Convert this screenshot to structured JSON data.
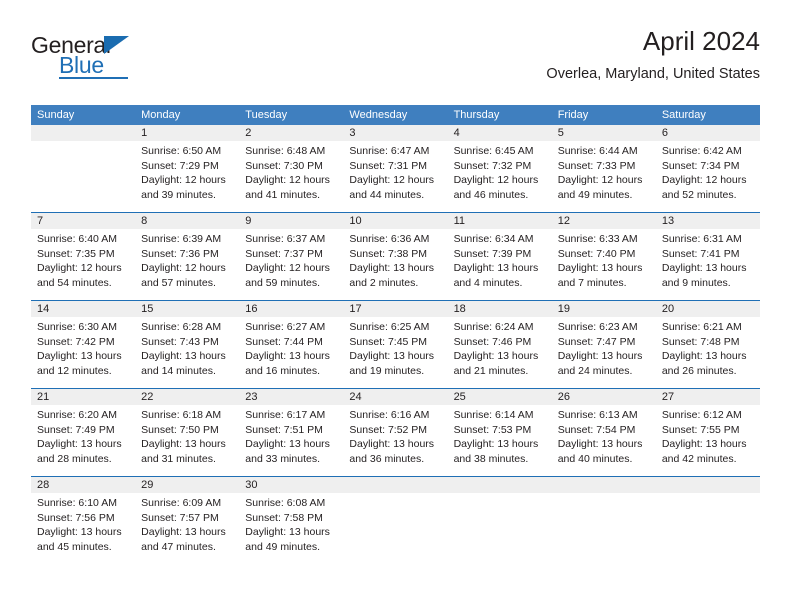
{
  "brand": {
    "name_part1": "General",
    "name_part2": "Blue"
  },
  "header": {
    "title": "April 2024",
    "subtitle": "Overlea, Maryland, United States"
  },
  "colors": {
    "header_blue": "#3f7fbf",
    "rule_blue": "#1f6fb5",
    "day_band_gray": "#efefef",
    "text": "#231f20"
  },
  "weekdays": [
    "Sunday",
    "Monday",
    "Tuesday",
    "Wednesday",
    "Thursday",
    "Friday",
    "Saturday"
  ],
  "weeks": [
    [
      {
        "day": "",
        "sunrise": "",
        "sunset": "",
        "daylight1": "",
        "daylight2": ""
      },
      {
        "day": "1",
        "sunrise": "Sunrise: 6:50 AM",
        "sunset": "Sunset: 7:29 PM",
        "daylight1": "Daylight: 12 hours",
        "daylight2": "and 39 minutes."
      },
      {
        "day": "2",
        "sunrise": "Sunrise: 6:48 AM",
        "sunset": "Sunset: 7:30 PM",
        "daylight1": "Daylight: 12 hours",
        "daylight2": "and 41 minutes."
      },
      {
        "day": "3",
        "sunrise": "Sunrise: 6:47 AM",
        "sunset": "Sunset: 7:31 PM",
        "daylight1": "Daylight: 12 hours",
        "daylight2": "and 44 minutes."
      },
      {
        "day": "4",
        "sunrise": "Sunrise: 6:45 AM",
        "sunset": "Sunset: 7:32 PM",
        "daylight1": "Daylight: 12 hours",
        "daylight2": "and 46 minutes."
      },
      {
        "day": "5",
        "sunrise": "Sunrise: 6:44 AM",
        "sunset": "Sunset: 7:33 PM",
        "daylight1": "Daylight: 12 hours",
        "daylight2": "and 49 minutes."
      },
      {
        "day": "6",
        "sunrise": "Sunrise: 6:42 AM",
        "sunset": "Sunset: 7:34 PM",
        "daylight1": "Daylight: 12 hours",
        "daylight2": "and 52 minutes."
      }
    ],
    [
      {
        "day": "7",
        "sunrise": "Sunrise: 6:40 AM",
        "sunset": "Sunset: 7:35 PM",
        "daylight1": "Daylight: 12 hours",
        "daylight2": "and 54 minutes."
      },
      {
        "day": "8",
        "sunrise": "Sunrise: 6:39 AM",
        "sunset": "Sunset: 7:36 PM",
        "daylight1": "Daylight: 12 hours",
        "daylight2": "and 57 minutes."
      },
      {
        "day": "9",
        "sunrise": "Sunrise: 6:37 AM",
        "sunset": "Sunset: 7:37 PM",
        "daylight1": "Daylight: 12 hours",
        "daylight2": "and 59 minutes."
      },
      {
        "day": "10",
        "sunrise": "Sunrise: 6:36 AM",
        "sunset": "Sunset: 7:38 PM",
        "daylight1": "Daylight: 13 hours",
        "daylight2": "and 2 minutes."
      },
      {
        "day": "11",
        "sunrise": "Sunrise: 6:34 AM",
        "sunset": "Sunset: 7:39 PM",
        "daylight1": "Daylight: 13 hours",
        "daylight2": "and 4 minutes."
      },
      {
        "day": "12",
        "sunrise": "Sunrise: 6:33 AM",
        "sunset": "Sunset: 7:40 PM",
        "daylight1": "Daylight: 13 hours",
        "daylight2": "and 7 minutes."
      },
      {
        "day": "13",
        "sunrise": "Sunrise: 6:31 AM",
        "sunset": "Sunset: 7:41 PM",
        "daylight1": "Daylight: 13 hours",
        "daylight2": "and 9 minutes."
      }
    ],
    [
      {
        "day": "14",
        "sunrise": "Sunrise: 6:30 AM",
        "sunset": "Sunset: 7:42 PM",
        "daylight1": "Daylight: 13 hours",
        "daylight2": "and 12 minutes."
      },
      {
        "day": "15",
        "sunrise": "Sunrise: 6:28 AM",
        "sunset": "Sunset: 7:43 PM",
        "daylight1": "Daylight: 13 hours",
        "daylight2": "and 14 minutes."
      },
      {
        "day": "16",
        "sunrise": "Sunrise: 6:27 AM",
        "sunset": "Sunset: 7:44 PM",
        "daylight1": "Daylight: 13 hours",
        "daylight2": "and 16 minutes."
      },
      {
        "day": "17",
        "sunrise": "Sunrise: 6:25 AM",
        "sunset": "Sunset: 7:45 PM",
        "daylight1": "Daylight: 13 hours",
        "daylight2": "and 19 minutes."
      },
      {
        "day": "18",
        "sunrise": "Sunrise: 6:24 AM",
        "sunset": "Sunset: 7:46 PM",
        "daylight1": "Daylight: 13 hours",
        "daylight2": "and 21 minutes."
      },
      {
        "day": "19",
        "sunrise": "Sunrise: 6:23 AM",
        "sunset": "Sunset: 7:47 PM",
        "daylight1": "Daylight: 13 hours",
        "daylight2": "and 24 minutes."
      },
      {
        "day": "20",
        "sunrise": "Sunrise: 6:21 AM",
        "sunset": "Sunset: 7:48 PM",
        "daylight1": "Daylight: 13 hours",
        "daylight2": "and 26 minutes."
      }
    ],
    [
      {
        "day": "21",
        "sunrise": "Sunrise: 6:20 AM",
        "sunset": "Sunset: 7:49 PM",
        "daylight1": "Daylight: 13 hours",
        "daylight2": "and 28 minutes."
      },
      {
        "day": "22",
        "sunrise": "Sunrise: 6:18 AM",
        "sunset": "Sunset: 7:50 PM",
        "daylight1": "Daylight: 13 hours",
        "daylight2": "and 31 minutes."
      },
      {
        "day": "23",
        "sunrise": "Sunrise: 6:17 AM",
        "sunset": "Sunset: 7:51 PM",
        "daylight1": "Daylight: 13 hours",
        "daylight2": "and 33 minutes."
      },
      {
        "day": "24",
        "sunrise": "Sunrise: 6:16 AM",
        "sunset": "Sunset: 7:52 PM",
        "daylight1": "Daylight: 13 hours",
        "daylight2": "and 36 minutes."
      },
      {
        "day": "25",
        "sunrise": "Sunrise: 6:14 AM",
        "sunset": "Sunset: 7:53 PM",
        "daylight1": "Daylight: 13 hours",
        "daylight2": "and 38 minutes."
      },
      {
        "day": "26",
        "sunrise": "Sunrise: 6:13 AM",
        "sunset": "Sunset: 7:54 PM",
        "daylight1": "Daylight: 13 hours",
        "daylight2": "and 40 minutes."
      },
      {
        "day": "27",
        "sunrise": "Sunrise: 6:12 AM",
        "sunset": "Sunset: 7:55 PM",
        "daylight1": "Daylight: 13 hours",
        "daylight2": "and 42 minutes."
      }
    ],
    [
      {
        "day": "28",
        "sunrise": "Sunrise: 6:10 AM",
        "sunset": "Sunset: 7:56 PM",
        "daylight1": "Daylight: 13 hours",
        "daylight2": "and 45 minutes."
      },
      {
        "day": "29",
        "sunrise": "Sunrise: 6:09 AM",
        "sunset": "Sunset: 7:57 PM",
        "daylight1": "Daylight: 13 hours",
        "daylight2": "and 47 minutes."
      },
      {
        "day": "30",
        "sunrise": "Sunrise: 6:08 AM",
        "sunset": "Sunset: 7:58 PM",
        "daylight1": "Daylight: 13 hours",
        "daylight2": "and 49 minutes."
      },
      {
        "day": "",
        "sunrise": "",
        "sunset": "",
        "daylight1": "",
        "daylight2": ""
      },
      {
        "day": "",
        "sunrise": "",
        "sunset": "",
        "daylight1": "",
        "daylight2": ""
      },
      {
        "day": "",
        "sunrise": "",
        "sunset": "",
        "daylight1": "",
        "daylight2": ""
      },
      {
        "day": "",
        "sunrise": "",
        "sunset": "",
        "daylight1": "",
        "daylight2": ""
      }
    ]
  ]
}
